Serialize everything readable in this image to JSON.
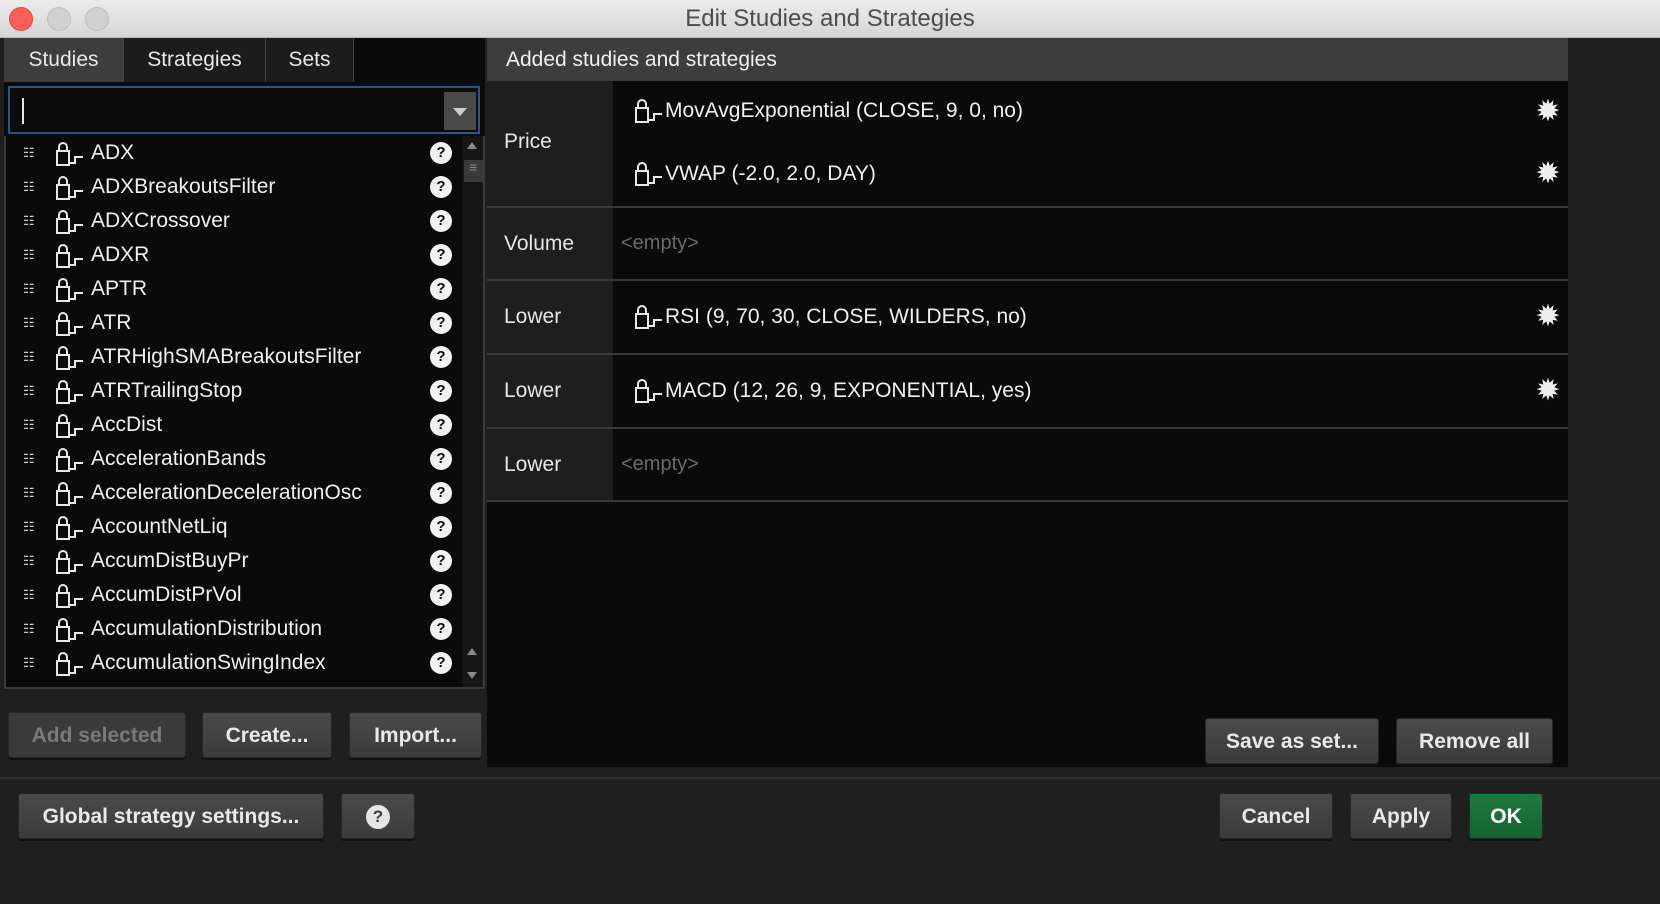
{
  "window": {
    "title": "Edit Studies and Strategies"
  },
  "left": {
    "tabs": [
      "Studies",
      "Strategies",
      "Sets"
    ],
    "search": {
      "value": "",
      "placeholder": ""
    },
    "studies": [
      "ADX",
      "ADXBreakoutsFilter",
      "ADXCrossover",
      "ADXR",
      "APTR",
      "ATR",
      "ATRHighSMABreakoutsFilter",
      "ATRTrailingStop",
      "AccDist",
      "AccelerationBands",
      "AccelerationDecelerationOsc",
      "AccountNetLiq",
      "AccumDistBuyPr",
      "AccumDistPrVol",
      "AccumulationDistribution",
      "AccumulationSwingIndex"
    ],
    "help_glyph": "?",
    "buttons": {
      "add_selected": "Add selected",
      "create": "Create...",
      "import": "Import..."
    }
  },
  "right": {
    "header": "Added studies and strategies",
    "slots": [
      {
        "label": "Price",
        "entries": [
          "MovAvgExponential (CLOSE, 9, 0, no)",
          "VWAP (-2.0, 2.0, DAY)"
        ]
      },
      {
        "label": "Volume",
        "empty_text": "<empty>"
      },
      {
        "label": "Lower",
        "entries": [
          "RSI (9, 70, 30, CLOSE, WILDERS, no)"
        ]
      },
      {
        "label": "Lower",
        "entries": [
          "MACD (12, 26, 9, EXPONENTIAL, yes)"
        ]
      },
      {
        "label": "Lower",
        "empty_text": "<empty>"
      }
    ],
    "buttons": {
      "save_as_set": "Save as set...",
      "remove_all": "Remove all"
    }
  },
  "footer": {
    "global_settings": "Global strategy settings...",
    "help": "?",
    "cancel": "Cancel",
    "apply": "Apply",
    "ok": "OK"
  },
  "colors": {
    "ok_button": "#1f7a3e",
    "selection_border": "#1f5a8a",
    "close_dot": "#fc5f57"
  },
  "icons": {
    "row_drag": "drag-handle-icon",
    "study": "locked-study-icon",
    "help": "help-circle-icon",
    "settings": "gear-icon"
  }
}
